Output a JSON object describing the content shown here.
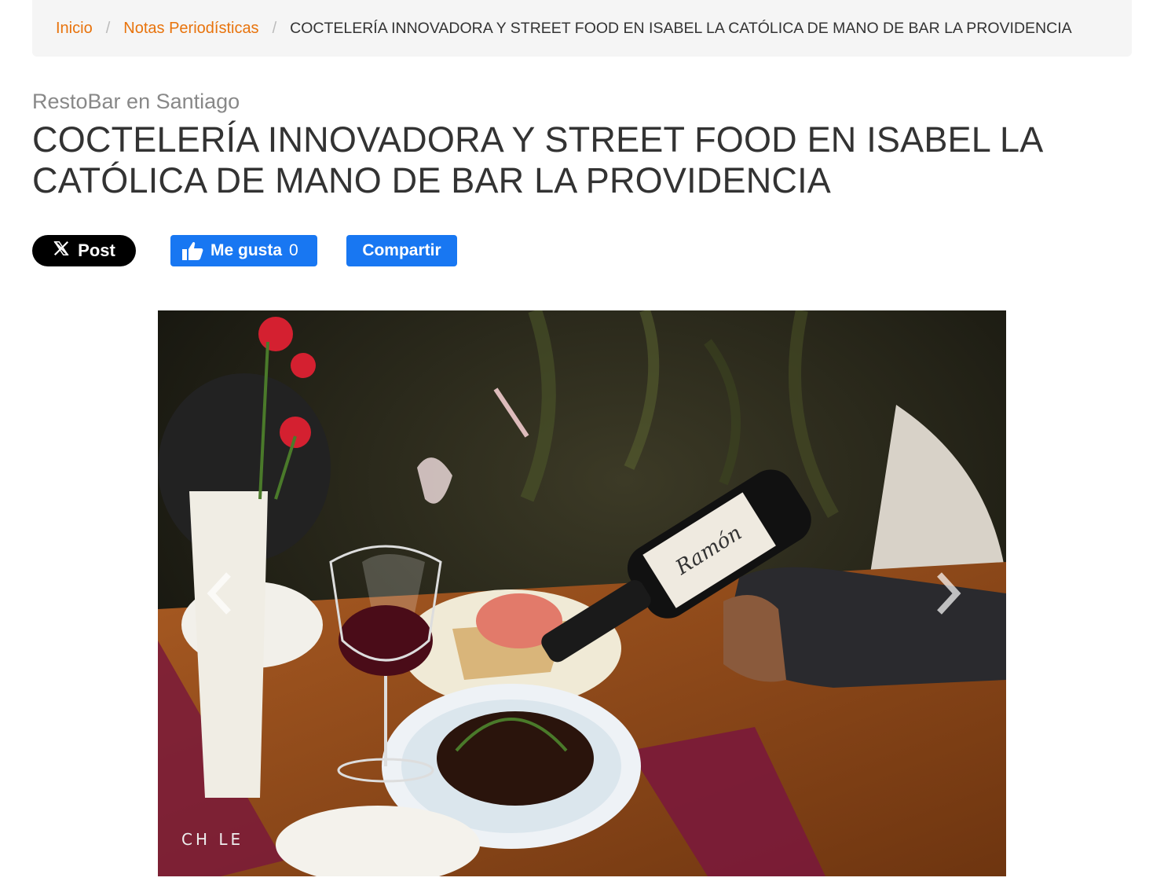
{
  "breadcrumb": {
    "items": [
      {
        "label": "Inicio"
      },
      {
        "label": "Notas Periodísticas"
      }
    ],
    "separator": "/",
    "current": "COCTELERÍA INNOVADORA Y STREET FOOD EN ISABEL LA CATÓLICA DE MANO DE BAR LA PROVIDENCIA"
  },
  "article": {
    "category": "RestoBar en Santiago",
    "title": "COCTELERÍA INNOVADORA Y STREET FOOD EN ISABEL LA CATÓLICA DE MANO DE BAR LA PROVIDENCIA"
  },
  "share": {
    "x_label": "Post",
    "like_label": "Me gusta",
    "like_count": "0",
    "share_label": "Compartir"
  },
  "carousel": {
    "watermark": "CH LE",
    "label_text": "Ramón"
  },
  "colors": {
    "link": "#e8730c",
    "facebook": "#1877f2",
    "title": "#333333",
    "category": "#888888"
  },
  "icons": [
    "x-logo-icon",
    "thumbs-up-icon",
    "chevron-left-icon",
    "chevron-right-icon"
  ]
}
